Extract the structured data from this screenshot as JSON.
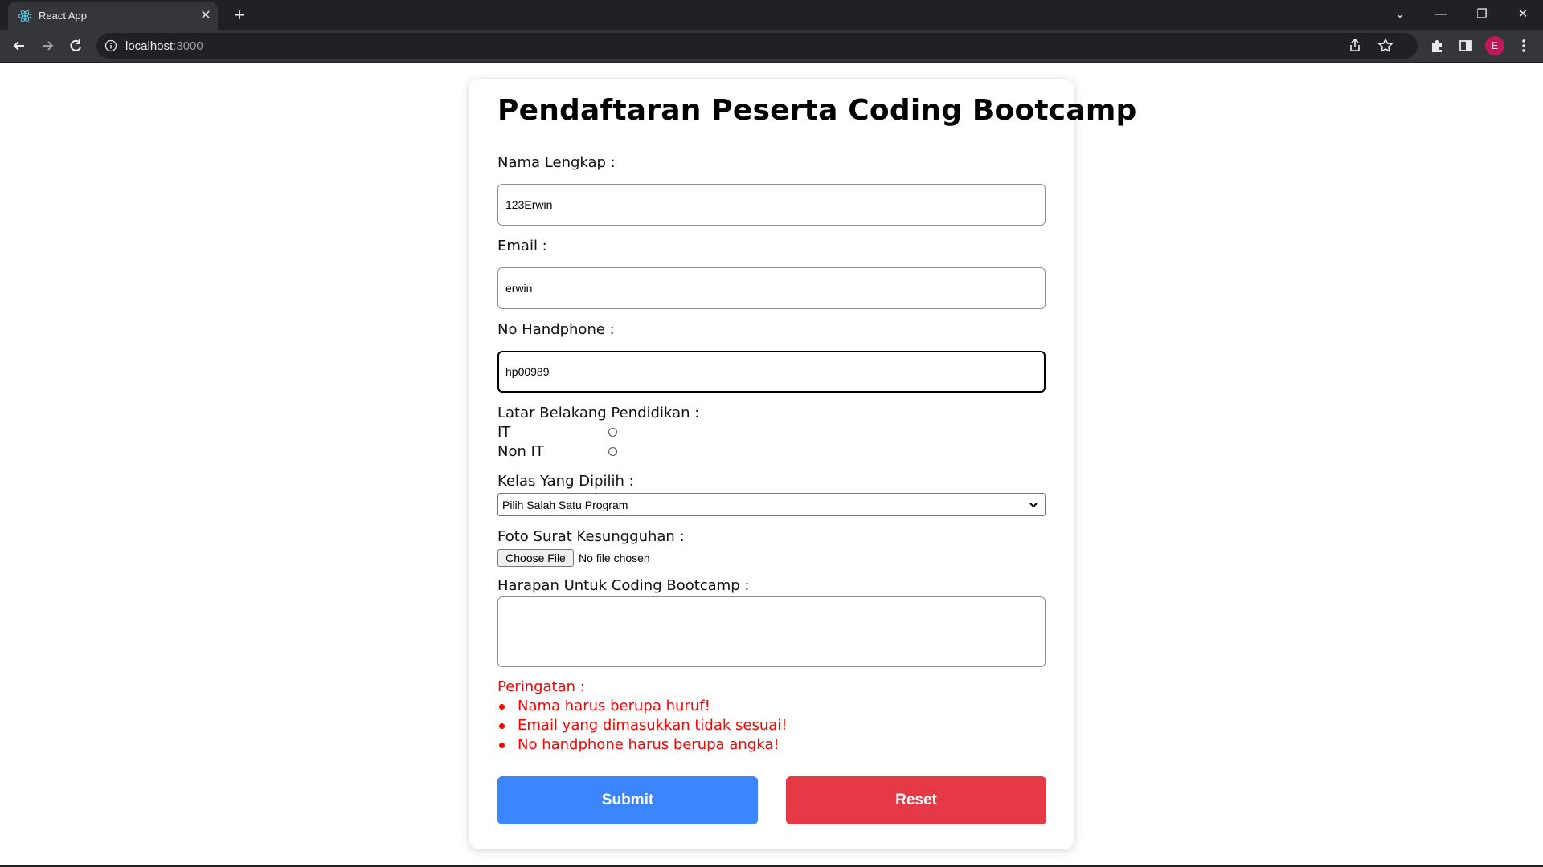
{
  "browser": {
    "tab_title": "React App",
    "url_host": "localhost",
    "url_port": ":3000",
    "profile_initial": "E"
  },
  "form": {
    "title": "Pendaftaran Peserta Coding Bootcamp",
    "nama": {
      "label": "Nama Lengkap :",
      "value": "123Erwin"
    },
    "email": {
      "label": "Email :",
      "value": "erwin"
    },
    "hp": {
      "label": "No Handphone :",
      "value": "hp00989"
    },
    "pendidikan": {
      "label": "Latar Belakang Pendidikan :",
      "options": [
        {
          "label": "IT",
          "checked": false
        },
        {
          "label": "Non IT",
          "checked": false
        }
      ]
    },
    "kelas": {
      "label": "Kelas Yang Dipilih :",
      "selected": "Pilih Salah Satu Program"
    },
    "foto": {
      "label": "Foto Surat Kesungguhan :",
      "button": "Choose File",
      "status": "No file chosen"
    },
    "harapan": {
      "label": "Harapan Untuk Coding Bootcamp :",
      "value": ""
    },
    "warnings": {
      "title": "Peringatan :",
      "items": [
        "Nama harus berupa huruf!",
        "Email yang dimasukkan tidak sesuai!",
        "No handphone harus berupa angka!"
      ]
    },
    "submit_label": "Submit",
    "reset_label": "Reset"
  },
  "colors": {
    "submit": "#3b86ff",
    "reset": "#e63946",
    "warning": "#ff0000"
  }
}
